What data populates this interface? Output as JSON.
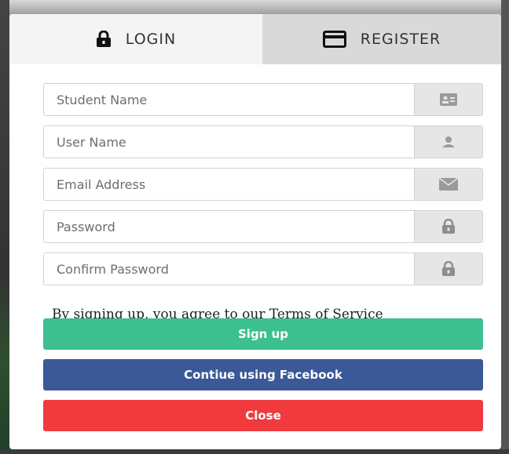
{
  "tabs": {
    "login": {
      "label": "LOGIN",
      "icon": "lock-icon"
    },
    "register": {
      "label": "REGISTER",
      "icon": "credit-card-icon"
    }
  },
  "form": {
    "fields": [
      {
        "placeholder": "Student Name",
        "icon": "id-card-icon"
      },
      {
        "placeholder": "User Name",
        "icon": "user-icon"
      },
      {
        "placeholder": "Email Address",
        "icon": "envelope-icon"
      },
      {
        "placeholder": "Password",
        "icon": "lock-icon"
      },
      {
        "placeholder": "Confirm Password",
        "icon": "lock-icon"
      }
    ],
    "terms_text": "By signing up, you agree to our Terms of Service"
  },
  "buttons": {
    "signup": "Sign up",
    "facebook": "Contiue using Facebook",
    "close": "Close"
  },
  "colors": {
    "signup": "#3cc08f",
    "facebook": "#3b5897",
    "close": "#f03a3e",
    "addon_bg": "#e6e6e6",
    "register_tab_bg": "#d9d9d9"
  }
}
